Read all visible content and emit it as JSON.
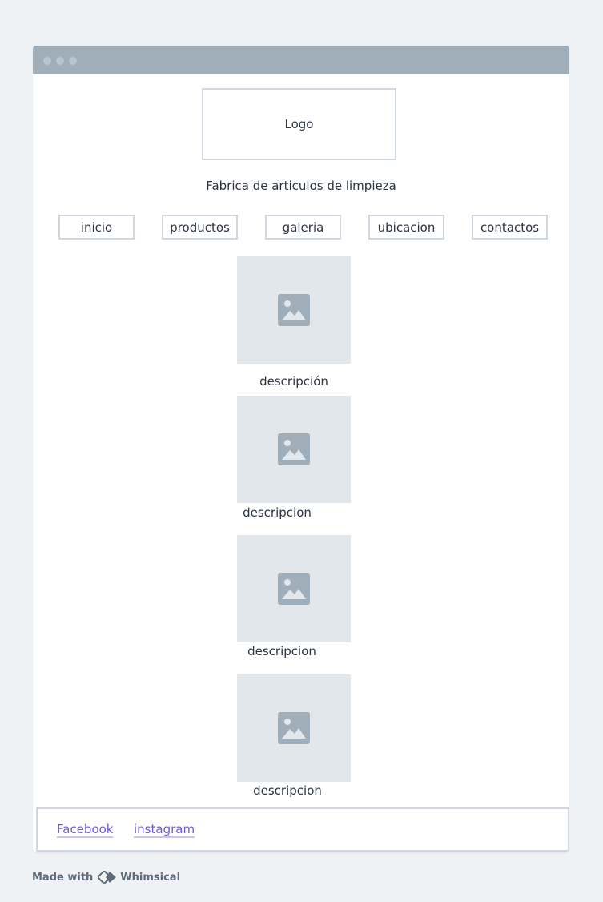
{
  "header": {
    "logo_text": "Logo",
    "subtitle": "Fabrica de articulos de limpieza"
  },
  "nav": [
    {
      "label": "inicio"
    },
    {
      "label": "productos"
    },
    {
      "label": "galeria"
    },
    {
      "label": "ubicacion"
    },
    {
      "label": "contactos"
    }
  ],
  "gallery": [
    {
      "icon": "image-icon",
      "description": "descripción"
    },
    {
      "icon": "image-icon",
      "description": "descripcion"
    },
    {
      "icon": "image-icon",
      "description": "descripcion"
    },
    {
      "icon": "image-icon",
      "description": "descripcion"
    }
  ],
  "footer": {
    "links": [
      {
        "label": "Facebook"
      },
      {
        "label": "instagram"
      }
    ]
  },
  "branding": {
    "prefix": "Made with",
    "name": "Whimsical"
  },
  "colors": {
    "titlebar": "#a0aeba",
    "border": "#cfd8e0",
    "link": "#6b5bd6",
    "placeholder": "#e2e7eb"
  }
}
